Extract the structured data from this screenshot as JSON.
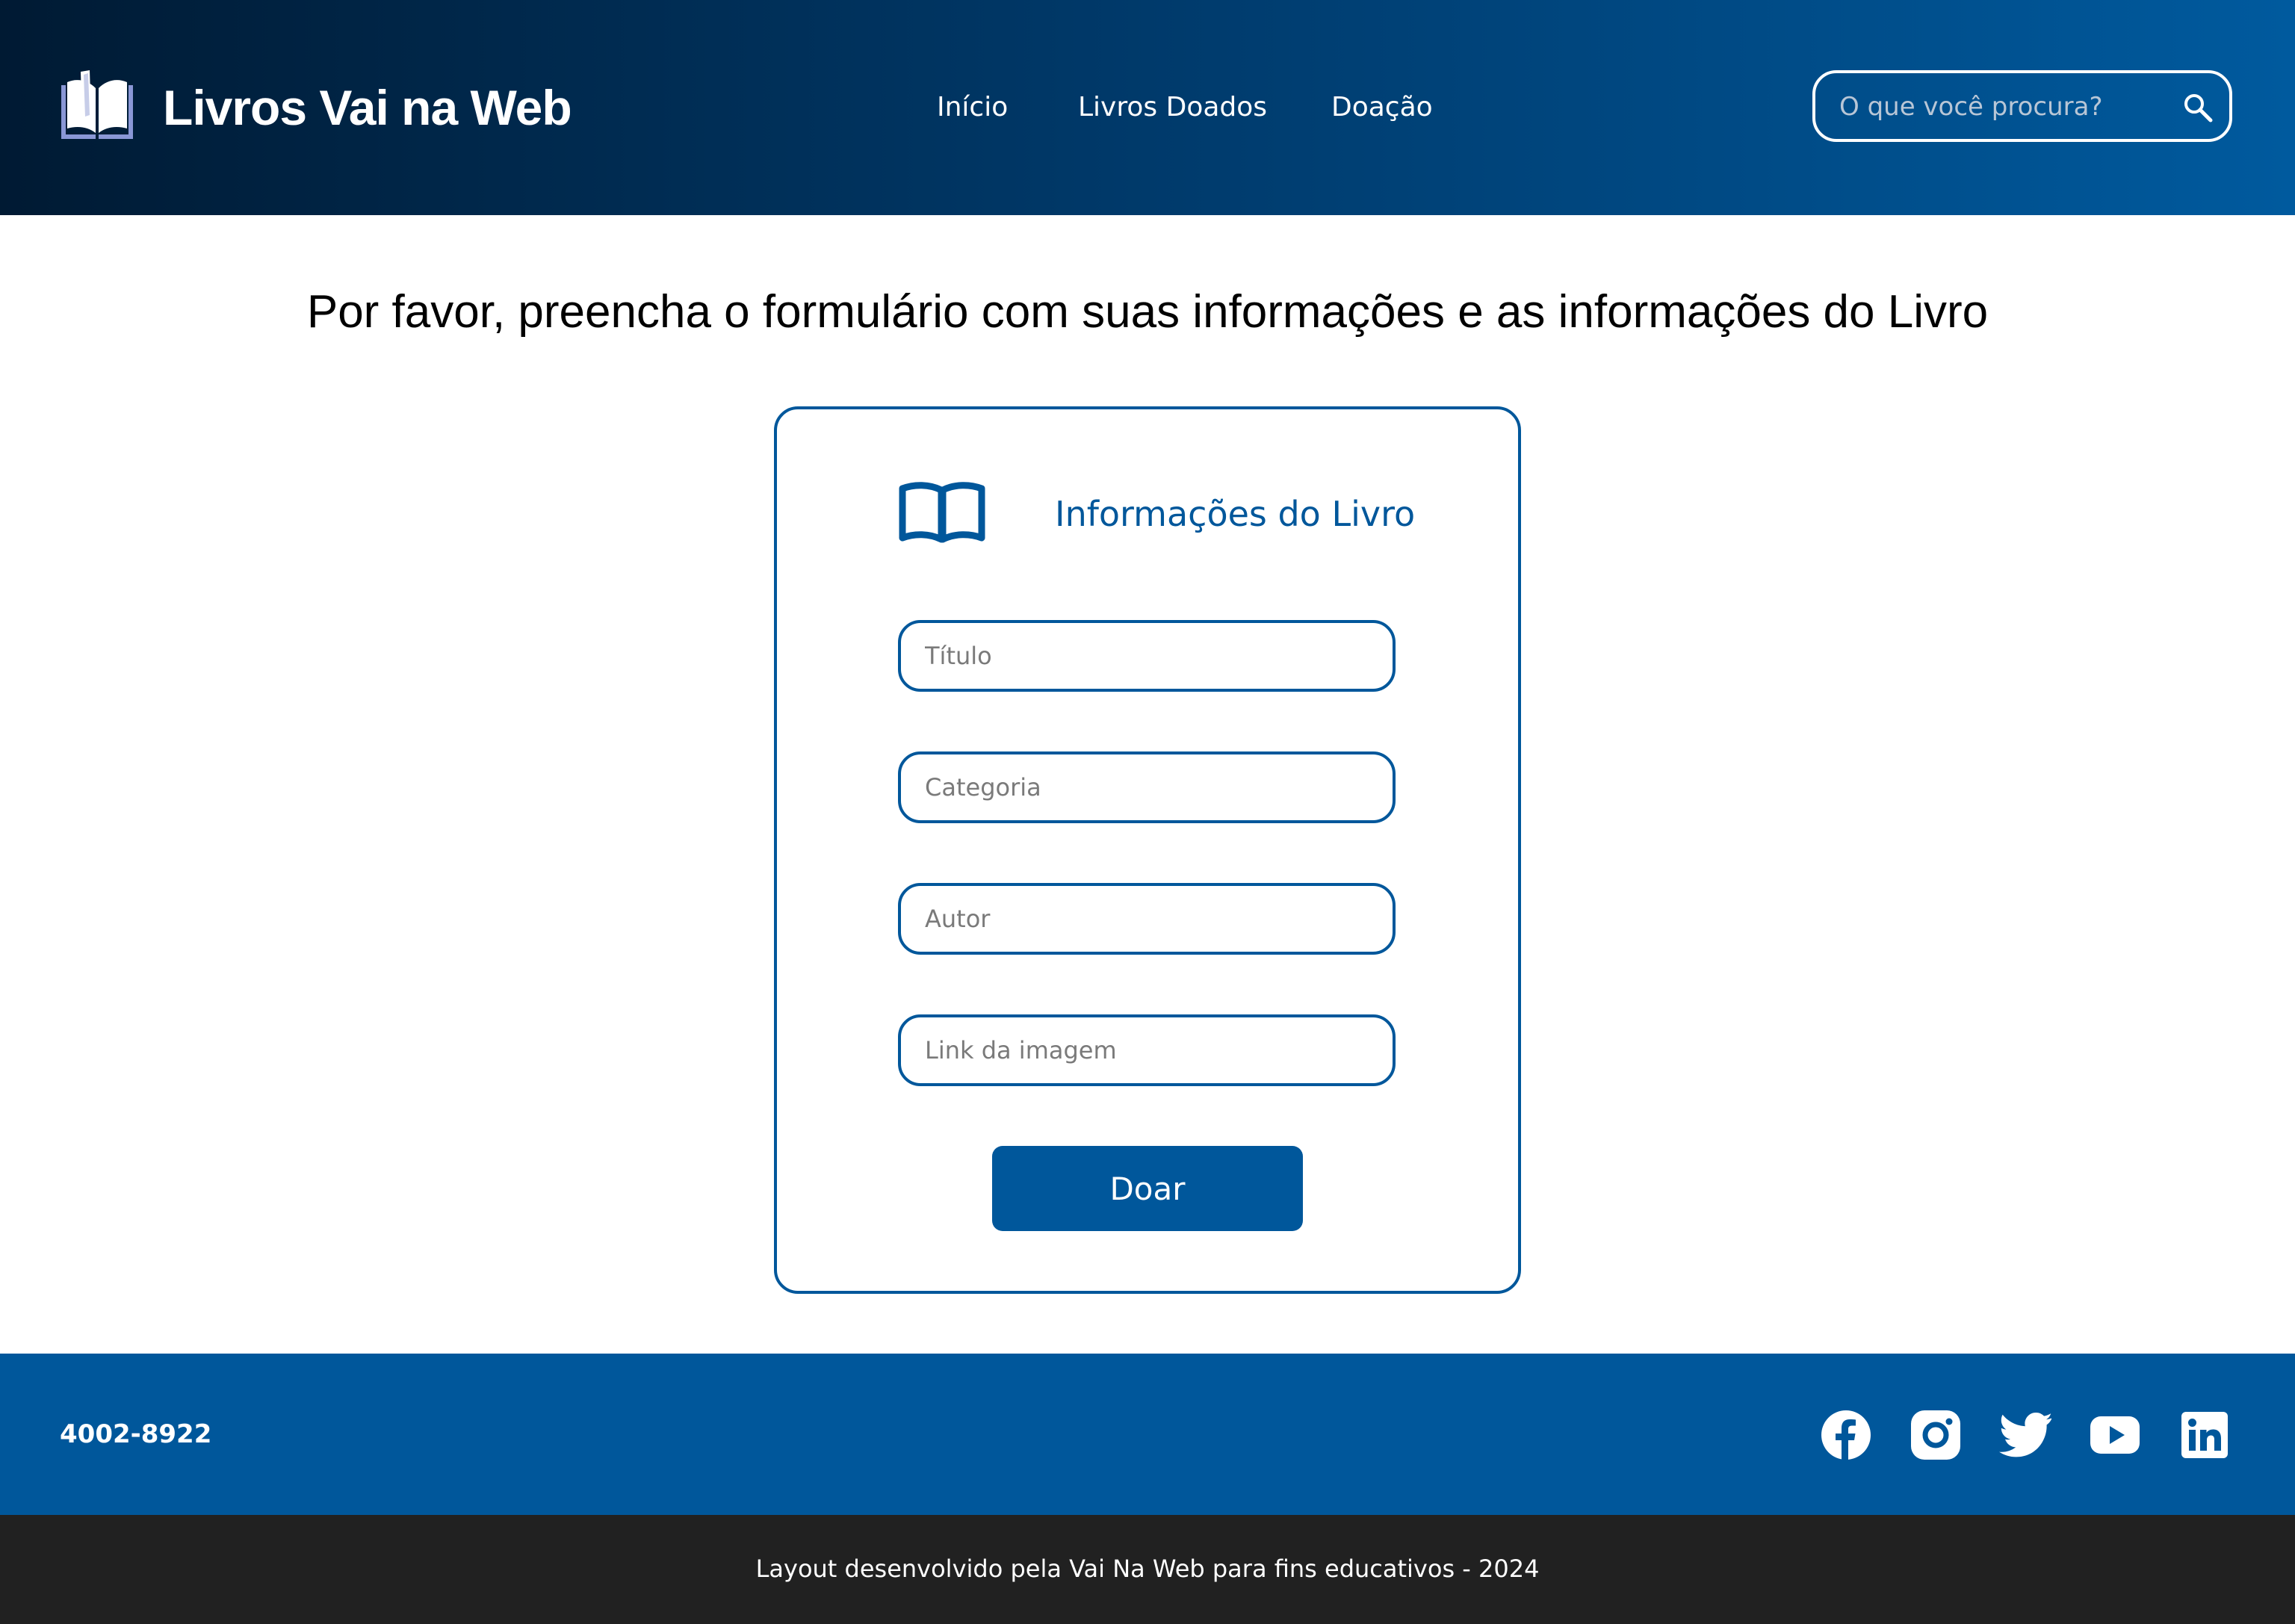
{
  "header": {
    "brand": "Livros Vai na Web",
    "nav": [
      "Início",
      "Livros Doados",
      "Doação"
    ],
    "search": {
      "placeholder": "O que você procura?",
      "icon": "search-icon"
    }
  },
  "main": {
    "title": "Por favor, preencha o formulário com suas informações e as informações do Livro",
    "card": {
      "heading": "Informações do Livro",
      "icon": "book-icon",
      "fields": [
        {
          "placeholder": "Título",
          "value": ""
        },
        {
          "placeholder": "Categoria",
          "value": ""
        },
        {
          "placeholder": "Autor",
          "value": ""
        },
        {
          "placeholder": "Link da imagem",
          "value": ""
        }
      ],
      "submit_label": "Doar"
    }
  },
  "footer": {
    "phone": "4002-8922",
    "social": [
      "facebook-icon",
      "instagram-icon",
      "twitter-icon",
      "youtube-icon",
      "linkedin-icon"
    ],
    "credit": "Layout desenvolvido pela Vai Na Web para fins educativos - 2024"
  },
  "colors": {
    "primary": "#00579b",
    "header_start": "#001a33",
    "header_end": "#005a9e",
    "bottom_bar": "#212121",
    "white": "#ffffff"
  }
}
